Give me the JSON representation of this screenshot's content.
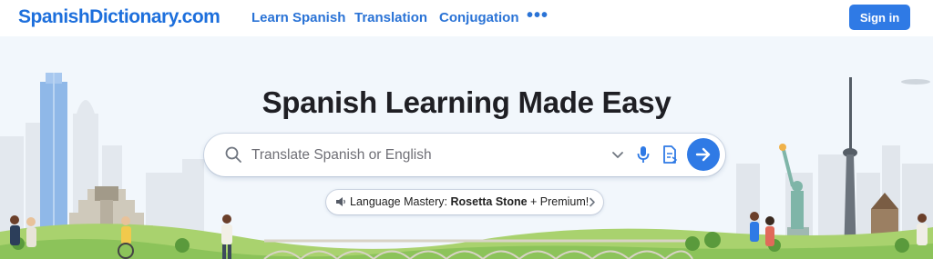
{
  "nav": {
    "logo": "SpanishDictionary.com",
    "links": [
      "Learn Spanish",
      "Translation",
      "Conjugation"
    ],
    "more": "•••",
    "signin": "Sign in"
  },
  "hero": {
    "headline": "Spanish Learning Made Easy",
    "search": {
      "placeholder": "Translate Spanish or English"
    },
    "promo": {
      "prefix": "Language Mastery: ",
      "brand": "Rosetta Stone",
      "suffix": " + Premium!"
    }
  },
  "icons": [
    "search-icon",
    "chevron-down-icon",
    "microphone-icon",
    "document-icon",
    "arrow-right-icon",
    "speaker-icon",
    "chevron-right-icon"
  ],
  "colors": {
    "brand": "#1d6fdc",
    "accent": "#2f7ae5",
    "hero_bg": "#f2f7fc",
    "grass": "#9ccc65"
  }
}
